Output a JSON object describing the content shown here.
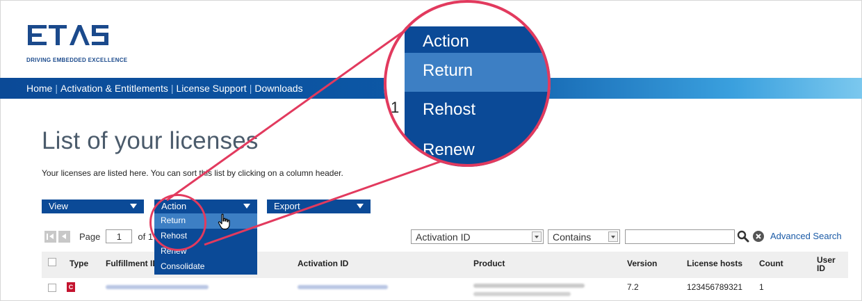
{
  "brand": {
    "logo_text": "ETAS",
    "tagline": "DRIVING EMBEDDED EXCELLENCE",
    "logo_color": "#1b4a8c"
  },
  "nav": {
    "items": [
      {
        "label": "Home"
      },
      {
        "label": "Activation & Entitlements"
      },
      {
        "label": "License Support"
      },
      {
        "label": "Downloads"
      }
    ],
    "separator": "|"
  },
  "page": {
    "title": "List of your licenses",
    "description": "Your licenses are listed here. You can sort this list by clicking on a column header."
  },
  "toolbar": {
    "view_label": "View",
    "action_label": "Action",
    "export_label": "Export"
  },
  "action_menu": {
    "items": [
      {
        "label": "Return",
        "hovered": true
      },
      {
        "label": "Rehost"
      },
      {
        "label": "Renew"
      },
      {
        "label": "Consolidate"
      }
    ]
  },
  "pager": {
    "page_label": "Page",
    "current_page": "1",
    "of_label": "of 1"
  },
  "search": {
    "field_select": "Activation ID",
    "operator_select": "Contains",
    "value": "",
    "advanced_label": "Advanced Search"
  },
  "table": {
    "headers": {
      "type": "Type",
      "fulfillment_id": "Fulfillment ID",
      "activation_id": "Activation ID",
      "product": "Product",
      "version": "Version",
      "license_hosts": "License hosts",
      "count": "Count",
      "user_id": "User ID"
    },
    "rows": [
      {
        "type_badge": "C",
        "version": "7.2",
        "license_hosts": "123456789321",
        "count": "1"
      }
    ]
  },
  "callout": {
    "title": "Action",
    "items": [
      "Return",
      "Rehost",
      "Renew"
    ],
    "side_number": "1"
  },
  "colors": {
    "primary": "#0b4a97",
    "menu_hover": "#3d7fc4",
    "highlight_ring": "#e23a5e",
    "type_badge": "#c4142f"
  }
}
